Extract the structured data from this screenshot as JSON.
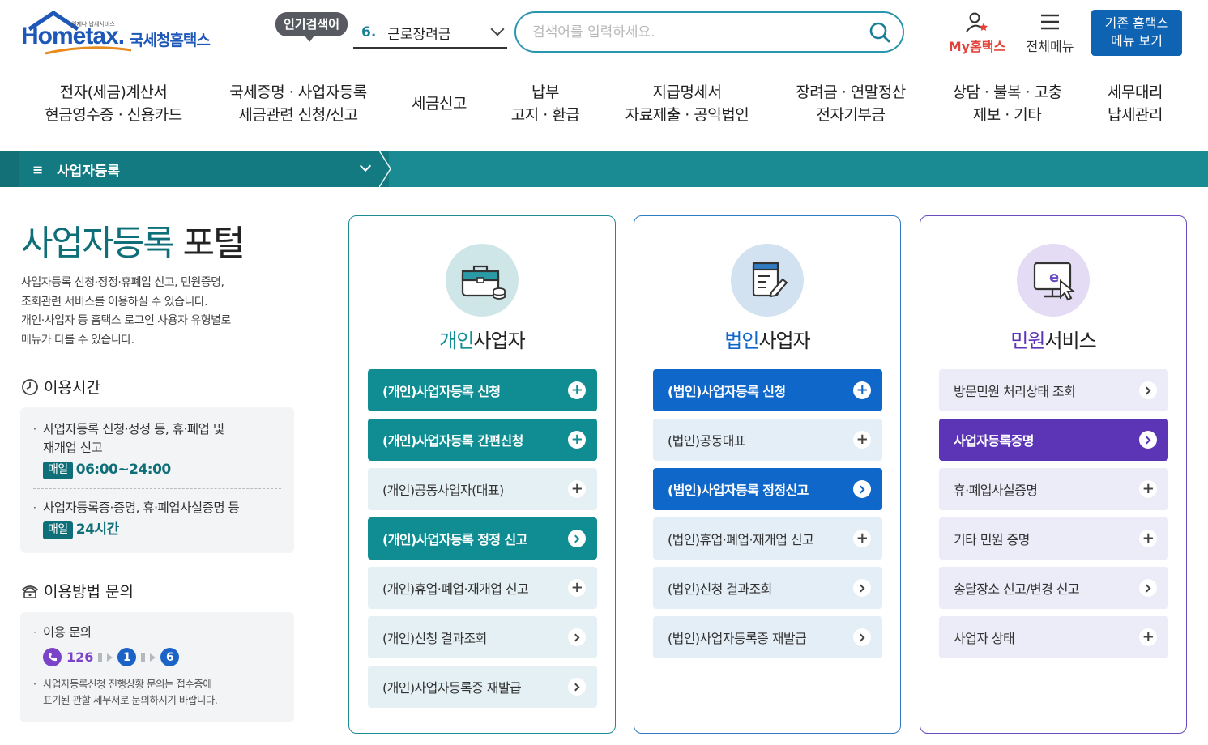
{
  "header": {
    "logo_word": "Hometax.",
    "logo_tag": "언제나 납세서비스",
    "logo_kor": "국세청홈택스",
    "popular_label": "인기검색어",
    "popular_rank": "6.",
    "popular_term": "근로장려금",
    "search_placeholder": "검색어를 입력하세요.",
    "my_label": "My홈택스",
    "allmenu_label": "전체메뉴",
    "old_menu_line1": "기존 홈택스",
    "old_menu_line2": "메뉴 보기"
  },
  "nav": [
    {
      "l1": "전자(세금)계산서",
      "l2": "현금영수증 · 신용카드"
    },
    {
      "l1": "국세증명 · 사업자등록",
      "l2": "세금관련 신청/신고"
    },
    {
      "l1": "세금신고",
      "l2": ""
    },
    {
      "l1": "납부",
      "l2": "고지 · 환급"
    },
    {
      "l1": "지급명세서",
      "l2": "자료제출 · 공익법인"
    },
    {
      "l1": "장려금 · 연말정산",
      "l2": "전자기부금"
    },
    {
      "l1": "상담 · 불복 · 고충",
      "l2": "제보 · 기타"
    },
    {
      "l1": "세무대리",
      "l2": "납세관리"
    }
  ],
  "breadcrumb": {
    "label": "사업자등록"
  },
  "left": {
    "title_accent": "사업자등록",
    "title_rest": "포털",
    "desc_lines": [
      "사업자등록 신청·정정·휴폐업 신고, 민원증명,",
      "조회관련 서비스를 이용하실 수 있습니다.",
      "개인·사업자 등 홈택스 로그인 사용자 유형별로",
      "메뉴가 다를 수 있습니다."
    ],
    "hours_title": "이용시간",
    "hours_item1_l1": "사업자등록 신청·정정 등, 휴·폐업 및",
    "hours_item1_l2": "재개업 신고",
    "hours_item1_badge": "매일",
    "hours_item1_time": "06:00~24:00",
    "hours_item2": "사업자등록증·증명, 휴·폐업사실증명 등",
    "hours_item2_badge": "매일",
    "hours_item2_time": "24시간",
    "inquiry_title": "이용방법 문의",
    "inquiry_label": "이용 문의",
    "inquiry_num": "126",
    "inquiry_step1": "1",
    "inquiry_step2": "6",
    "inquiry_note_l1": "사업자등록신청 진행상황 문의는 접수증에",
    "inquiry_note_l2": "표기된 관할 세무서로 문의하시기 바랍니다."
  },
  "cards": [
    {
      "title_accent": "개인",
      "title_rest": "사업자",
      "accent": "#0f8d93",
      "items": [
        {
          "label": "(개인)사업자등록 신청",
          "style": "dark",
          "icon": "plus"
        },
        {
          "label": "(개인)사업자등록 간편신청",
          "style": "dark",
          "icon": "plus"
        },
        {
          "label": "(개인)공동사업자(대표)",
          "style": "light",
          "icon": "plus"
        },
        {
          "label": "(개인)사업자등록 정정 신고",
          "style": "dark",
          "icon": "arrow"
        },
        {
          "label": "(개인)휴업·폐업·재개업 신고",
          "style": "light",
          "icon": "plus"
        },
        {
          "label": "(개인)신청 결과조회",
          "style": "light",
          "icon": "arrow"
        },
        {
          "label": "(개인)사업자등록증 재발급",
          "style": "light",
          "icon": "arrow"
        }
      ]
    },
    {
      "title_accent": "법인",
      "title_rest": "사업자",
      "accent": "#0f67c9",
      "items": [
        {
          "label": "(법인)사업자등록 신청",
          "style": "dark",
          "icon": "plus"
        },
        {
          "label": "(법인)공동대표",
          "style": "light",
          "icon": "plus"
        },
        {
          "label": "(법인)사업자등록 정정신고",
          "style": "dark",
          "icon": "arrow"
        },
        {
          "label": "(법인)휴업·폐업·재개업 신고",
          "style": "light",
          "icon": "plus"
        },
        {
          "label": "(법인)신청 결과조회",
          "style": "light",
          "icon": "arrow"
        },
        {
          "label": "(법인)사업자등록증 재발급",
          "style": "light",
          "icon": "arrow"
        }
      ]
    },
    {
      "title_accent": "민원",
      "title_rest": "서비스",
      "accent": "#5b35b5",
      "items": [
        {
          "label": "방문민원 처리상태 조회",
          "style": "light",
          "icon": "arrow"
        },
        {
          "label": "사업자등록증명",
          "style": "dark",
          "icon": "arrow"
        },
        {
          "label": "휴·폐업사실증명",
          "style": "light",
          "icon": "plus"
        },
        {
          "label": "기타 민원 증명",
          "style": "light",
          "icon": "plus"
        },
        {
          "label": "송달장소 신고/변경 신고",
          "style": "light",
          "icon": "arrow"
        },
        {
          "label": "사업자 상태",
          "style": "light",
          "icon": "plus"
        }
      ]
    }
  ],
  "colors": {
    "teal": "#0f8d93",
    "blue": "#0f67c9",
    "purple": "#5b35b5",
    "teal_light": "#e4f0f3",
    "blue_light": "#e3eef6",
    "purple_light": "#ecebf8"
  }
}
